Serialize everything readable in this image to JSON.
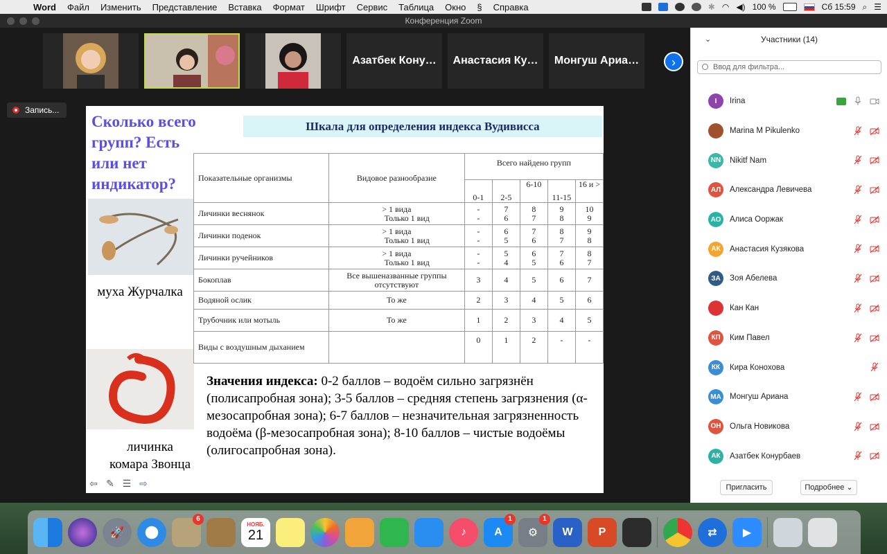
{
  "menubar": {
    "app": "Word",
    "items": [
      "Файл",
      "Изменить",
      "Представление",
      "Вставка",
      "Формат",
      "Шрифт",
      "Сервис",
      "Таблица",
      "Окно",
      "Справка"
    ],
    "battery": "100 %",
    "clock": "Сб 15:59"
  },
  "window": {
    "title": "Конференция Zoom"
  },
  "videos": {
    "names": [
      "Азатбек Кону…",
      "Анастасия Ку…",
      "Монгуш Ариа…"
    ]
  },
  "recording": {
    "label": "Запись..."
  },
  "slide": {
    "question": "Сколько всего групп? Есть или нет индикатор?",
    "title": "Шкала для определения индекса Вудивисса",
    "caption1": "муха Журчалка",
    "caption2_line1": "личинка",
    "caption2_line2": "комара Звонца",
    "table": {
      "h_org": "Показательные организмы",
      "h_div": "Видовое разнообразие",
      "h_total": "Всего найдено групп",
      "cols": [
        "0-1",
        "2-5",
        "6-10",
        "11-15",
        "16 и >"
      ],
      "rows": [
        {
          "org": "Личинки веснянок",
          "div1": "> 1 вида",
          "div2": "Только 1 вид",
          "v1": [
            "-",
            "7",
            "8",
            "9",
            "10"
          ],
          "v2": [
            "-",
            "6",
            "7",
            "8",
            "9"
          ]
        },
        {
          "org": "Личинки поденок",
          "div1": "> 1 вида",
          "div2": "Только 1 вид",
          "v1": [
            "-",
            "6",
            "7",
            "8",
            "9"
          ],
          "v2": [
            "-",
            "5",
            "6",
            "7",
            "8"
          ]
        },
        {
          "org": "Личинки ручейников",
          "div1": "> 1 вида",
          "div2": "Только 1 вид",
          "v1": [
            "-",
            "5",
            "6",
            "7",
            "8"
          ],
          "v2": [
            "-",
            "4",
            "5",
            "6",
            "7"
          ]
        },
        {
          "org": "Бокоплав",
          "div1": "Все вышеназванные группы",
          "div2": "отсутствуют",
          "v1": [
            "3",
            "4",
            "5",
            "6",
            "7"
          ]
        },
        {
          "org": "Водяной ослик",
          "div1": "То же",
          "v1": [
            "2",
            "3",
            "4",
            "5",
            "6"
          ]
        },
        {
          "org": "Трубочник или мотыль",
          "div1": "То же",
          "v1": [
            "1",
            "2",
            "3",
            "4",
            "5"
          ]
        },
        {
          "org": "Виды с воздушным дыханием",
          "div1": "",
          "v1": [
            "0",
            "1",
            "2",
            "-",
            "-"
          ]
        }
      ]
    },
    "index_label": "Значения индекса:",
    "index_text": " 0-2 баллов – водоём сильно загрязнён (полисапробная зона); 3-5 баллов – средняя степень загрязнения (α-мезосапробная зона); 6-7 баллов – незначительная загрязненность водоёма (β-мезосапробная зона); 8-10 баллов – чистые водоёмы (олигосапробная зона)."
  },
  "participants": {
    "header": "Участники (14)",
    "filter_placeholder": "Ввод для фильтра...",
    "list": [
      {
        "initials": "I",
        "name": "Irina",
        "color": "#8e44ad"
      },
      {
        "initials": "",
        "name": "Marina M Pikulenko",
        "color": "#a0522d"
      },
      {
        "initials": "NN",
        "name": "Nikitf Nam",
        "color": "#3ab7a8"
      },
      {
        "initials": "АЛ",
        "name": "Александра Левичева",
        "color": "#e0533f"
      },
      {
        "initials": "АО",
        "name": "Алиса Ооржак",
        "color": "#2ab3a4"
      },
      {
        "initials": "АК",
        "name": "Анастасия Кузякова",
        "color": "#f3a530"
      },
      {
        "initials": "ЗА",
        "name": "Зоя Абелева",
        "color": "#2e5c8a"
      },
      {
        "initials": "",
        "name": "Кан Кан",
        "color": "#d33"
      },
      {
        "initials": "КП",
        "name": "Ким Павел",
        "color": "#e0533f"
      },
      {
        "initials": "КК",
        "name": "Кира Конохова",
        "color": "#3a8ed6"
      },
      {
        "initials": "МА",
        "name": "Монгуш Ариана",
        "color": "#3a8ed6"
      },
      {
        "initials": "ОН",
        "name": "Ольга Новикова",
        "color": "#e0533f"
      },
      {
        "initials": "АК",
        "name": "Азатбек Конурбаев",
        "color": "#2ab3a4"
      }
    ],
    "invite_label": "Пригласить",
    "more_label": "Подробнее"
  },
  "dock": {
    "calendar_month": "НОЯБ.",
    "calendar_day": "21",
    "badges": {
      "contacts": "6",
      "appstore": "1",
      "prefs": "1"
    }
  }
}
